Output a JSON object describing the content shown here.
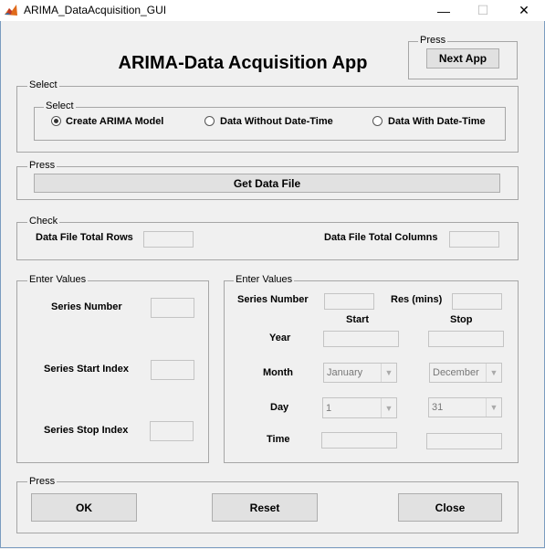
{
  "window": {
    "title": "ARIMA_DataAcquisition_GUI",
    "minimize_glyph": "—",
    "maximize_glyph": "☐",
    "close_glyph": "✕"
  },
  "app_title": "ARIMA-Data Acquisition App",
  "next_panel": {
    "label": "Press",
    "button": "Next App"
  },
  "select_panel": {
    "label": "Select",
    "inner_label": "Select",
    "options": [
      {
        "label": "Create ARIMA Model",
        "selected": true
      },
      {
        "label": "Data Without Date-Time",
        "selected": false
      },
      {
        "label": "Data With Date-Time",
        "selected": false
      }
    ]
  },
  "data_file_panel": {
    "label": "Press",
    "button": "Get Data File"
  },
  "check_panel": {
    "label": "Check",
    "rows_label": "Data File Total Rows",
    "cols_label": "Data File Total Columns",
    "rows_value": "",
    "cols_value": ""
  },
  "left_values": {
    "label": "Enter Values",
    "series_number": "Series Number",
    "series_start_index": "Series Start Index",
    "series_stop_index": "Series Stop Index"
  },
  "right_values": {
    "label": "Enter Values",
    "series_number": "Series Number",
    "res_mins": "Res (mins)",
    "start": "Start",
    "stop": "Stop",
    "year": "Year",
    "month": "Month",
    "day": "Day",
    "time": "Time",
    "start_month": "January",
    "stop_month": "December",
    "start_day": "1",
    "stop_day": "31"
  },
  "actions_panel": {
    "label": "Press",
    "ok": "OK",
    "reset": "Reset",
    "close": "Close"
  },
  "colors": {
    "background": "#f0f0f0",
    "button": "#e1e1e1",
    "border": "#a6a6a6"
  }
}
